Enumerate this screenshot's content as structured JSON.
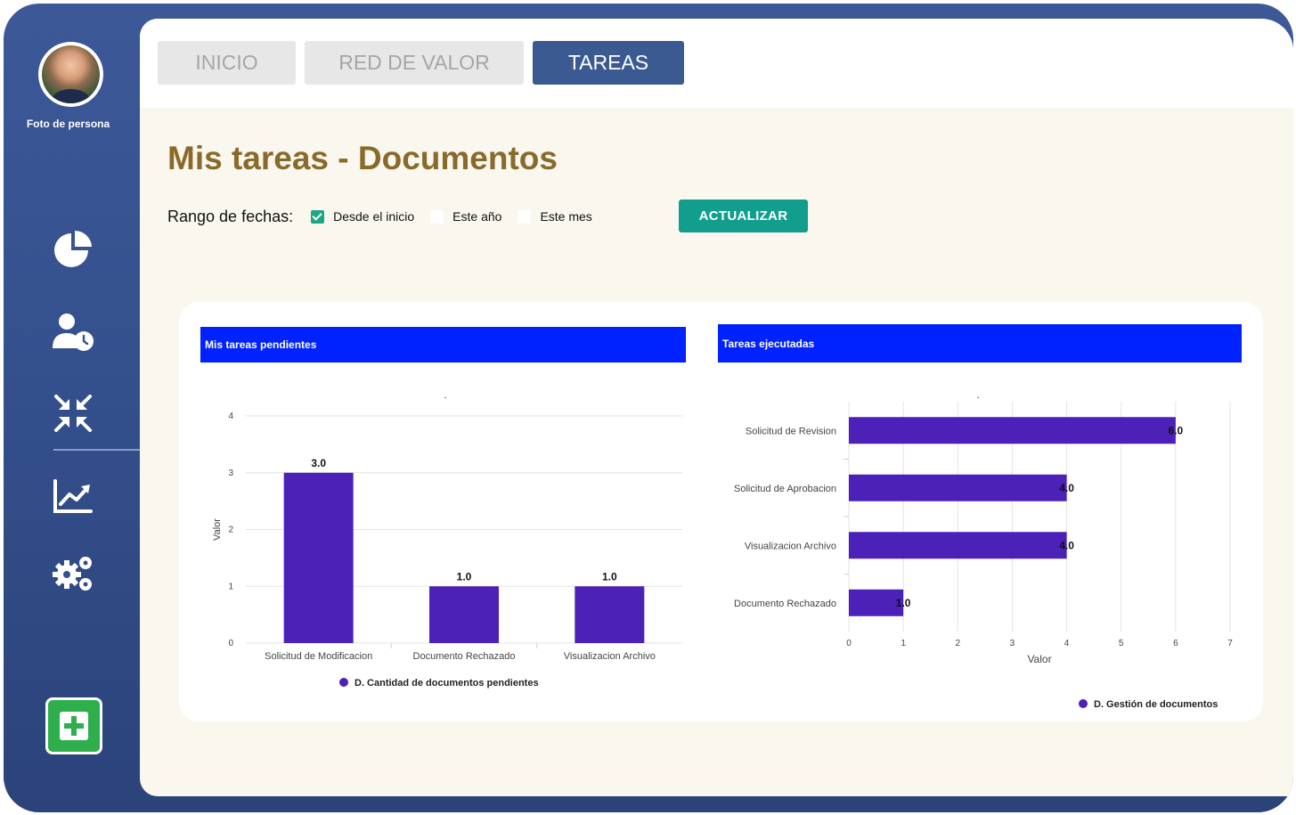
{
  "sidebar": {
    "avatar_caption": "Foto de persona",
    "icons": [
      "pie-chart-icon",
      "user-clock-icon",
      "compress-arrows-icon",
      "trend-chart-icon",
      "gears-icon"
    ],
    "add_icon": "plus-icon"
  },
  "tabs": [
    {
      "label": "INICIO",
      "active": false
    },
    {
      "label": "RED DE VALOR",
      "active": false
    },
    {
      "label": "TAREAS",
      "active": true
    }
  ],
  "page": {
    "title": "Mis tareas - Documentos",
    "filters": {
      "label": "Rango de fechas:",
      "options": [
        {
          "label": "Desde el inicio",
          "checked": true
        },
        {
          "label": "Este año",
          "checked": false
        },
        {
          "label": "Este mes",
          "checked": false
        }
      ]
    },
    "update_label": "ACTUALIZAR"
  },
  "colors": {
    "bar": "#4c21b8",
    "header": "#0022ff",
    "title": "#8a6a2b",
    "active_tab": "#3b5a92",
    "update": "#129e8d"
  },
  "chart_data": [
    {
      "type": "bar",
      "header": "Mis tareas pendientes",
      "title": ".",
      "categories": [
        "Solicitud de Modificacion",
        "Documento Rechazado",
        "Visualizacion Archivo"
      ],
      "series": [
        {
          "name": "D. Cantidad de documentos pendientes",
          "values": [
            3.0,
            1.0,
            1.0
          ]
        }
      ],
      "data_labels": [
        "3.0",
        "1.0",
        "1.0"
      ],
      "ylabel": "Valor",
      "ylim": [
        0,
        4
      ],
      "yticks": [
        "0",
        "1",
        "2",
        "3",
        "4"
      ],
      "grid": true,
      "legend": "bottom"
    },
    {
      "type": "bar",
      "orientation": "horizontal",
      "header": "Tareas ejecutadas",
      "title": ".",
      "categories": [
        "Solicitud de Revision",
        "Solicitud de Aprobacion",
        "Visualizacion Archivo",
        "Documento Rechazado"
      ],
      "series": [
        {
          "name": "D. Gestión de documentos",
          "values": [
            6.0,
            4.0,
            4.0,
            1.0
          ]
        }
      ],
      "data_labels": [
        "6.0",
        "4.0",
        "4.0",
        "1.0"
      ],
      "xlabel": "Valor",
      "xlim": [
        0,
        7
      ],
      "xticks": [
        "0",
        "1",
        "2",
        "3",
        "4",
        "5",
        "6",
        "7"
      ],
      "grid": true,
      "legend": "bottom"
    }
  ]
}
